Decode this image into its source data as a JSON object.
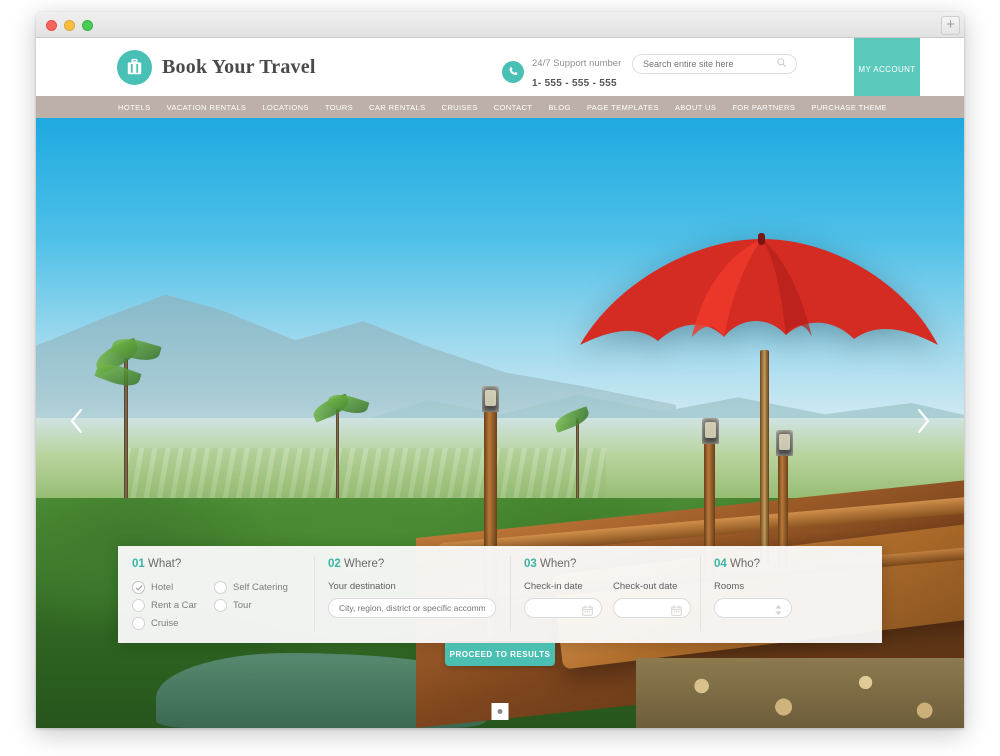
{
  "window": {
    "traffic_lights": [
      "close",
      "minimize",
      "maximize"
    ],
    "new_tab_label": "+"
  },
  "header": {
    "brand_name": "Book Your Travel",
    "brand_icon": "suitcase-icon",
    "support": {
      "icon": "phone-icon",
      "label": "24/7 Support number",
      "number": "1- 555 - 555 - 555"
    },
    "search": {
      "placeholder": "Search entire site here",
      "value": "",
      "icon": "search-icon"
    },
    "account_ribbon": "MY ACCOUNT"
  },
  "nav": {
    "items": [
      "HOTELS",
      "VACATION RENTALS",
      "LOCATIONS",
      "TOURS",
      "CAR RENTALS",
      "CRUISES",
      "CONTACT",
      "BLOG",
      "PAGE TEMPLATES",
      "ABOUT US",
      "FOR PARTNERS",
      "PURCHASE THEME"
    ]
  },
  "slider": {
    "prev_icon": "chevron-left-icon",
    "next_icon": "chevron-right-icon",
    "pager_icon": "dot-icon"
  },
  "booking": {
    "step1": {
      "number": "01",
      "title": "What?",
      "options": [
        {
          "label": "Hotel",
          "checked": true
        },
        {
          "label": "Self Catering",
          "checked": false
        },
        {
          "label": "Rent a Car",
          "checked": false
        },
        {
          "label": "Tour",
          "checked": false
        },
        {
          "label": "Cruise",
          "checked": false
        }
      ]
    },
    "step2": {
      "number": "02",
      "title": "Where?",
      "field_label": "Your destination",
      "placeholder": "City, region, district or specific accommoc",
      "value": ""
    },
    "step3": {
      "number": "03",
      "title": "When?",
      "checkin_label": "Check-in date",
      "checkin_value": "",
      "checkout_label": "Check-out date",
      "checkout_value": "",
      "icon": "calendar-icon"
    },
    "step4": {
      "number": "04",
      "title": "Who?",
      "rooms_label": "Rooms",
      "rooms_value": "",
      "icon": "stepper-updown-icon"
    },
    "submit_label": "PROCEED TO RESULTS"
  },
  "colors": {
    "accent_teal": "#49c0b5",
    "ribbon_teal": "#5cc9bd",
    "nav_taupe": "#bdb0a8",
    "button_teal": "#4cbfb3",
    "step_number": "#3ab3a7"
  }
}
